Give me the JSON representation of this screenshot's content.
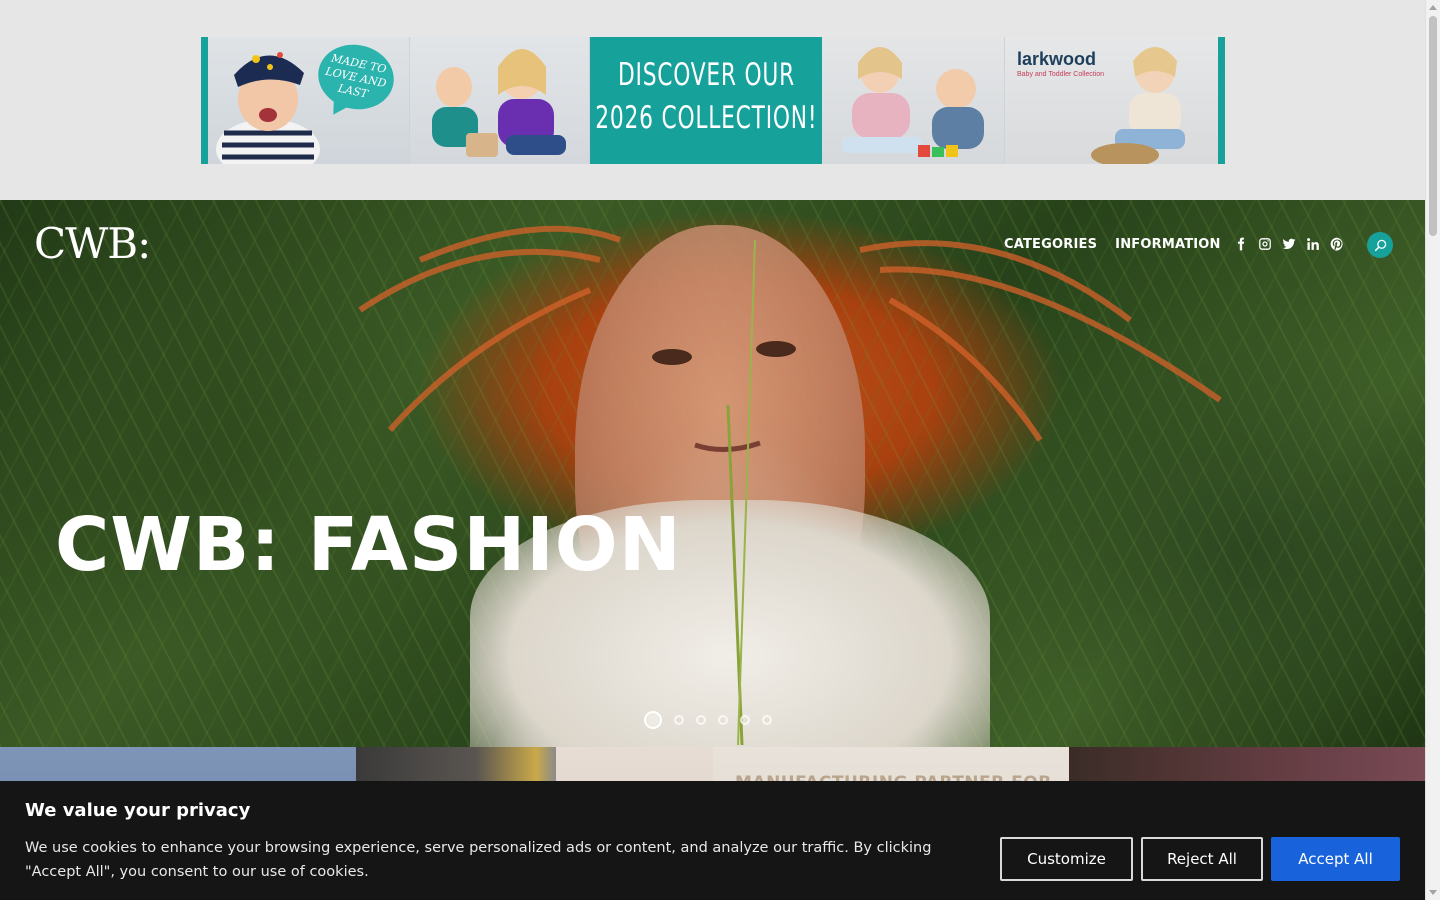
{
  "ad_banner": {
    "bubble_text": "MADE TO LOVE AND LAST",
    "headline_line1": "DISCOVER OUR",
    "headline_line2": "2026 COLLECTION!",
    "brand_name": "larkwood",
    "brand_tagline": "Baby and Toddler Collection",
    "accent_color": "#17a19b"
  },
  "header": {
    "logo_text": "CWB:",
    "nav": [
      {
        "label": "CATEGORIES"
      },
      {
        "label": "INFORMATION"
      }
    ],
    "socials": [
      "facebook-icon",
      "instagram-icon",
      "twitter-icon",
      "linkedin-icon",
      "pinterest-icon"
    ],
    "search_icon": "search-icon",
    "search_button_color": "#17a19b"
  },
  "hero": {
    "title": "CWB: FASHION",
    "slides_total": 6,
    "active_slide": 1
  },
  "strip": {
    "caption": "MANUFACTURING PARTNER FOR"
  },
  "cookie": {
    "title": "We value your privacy",
    "text": "We use cookies to enhance your browsing experience, serve personalized ads or content, and analyze our traffic. By clicking \"Accept All\", you consent to our use of cookies.",
    "customize_label": "Customize",
    "reject_label": "Reject All",
    "accept_label": "Accept All",
    "accept_color": "#1863dc"
  }
}
